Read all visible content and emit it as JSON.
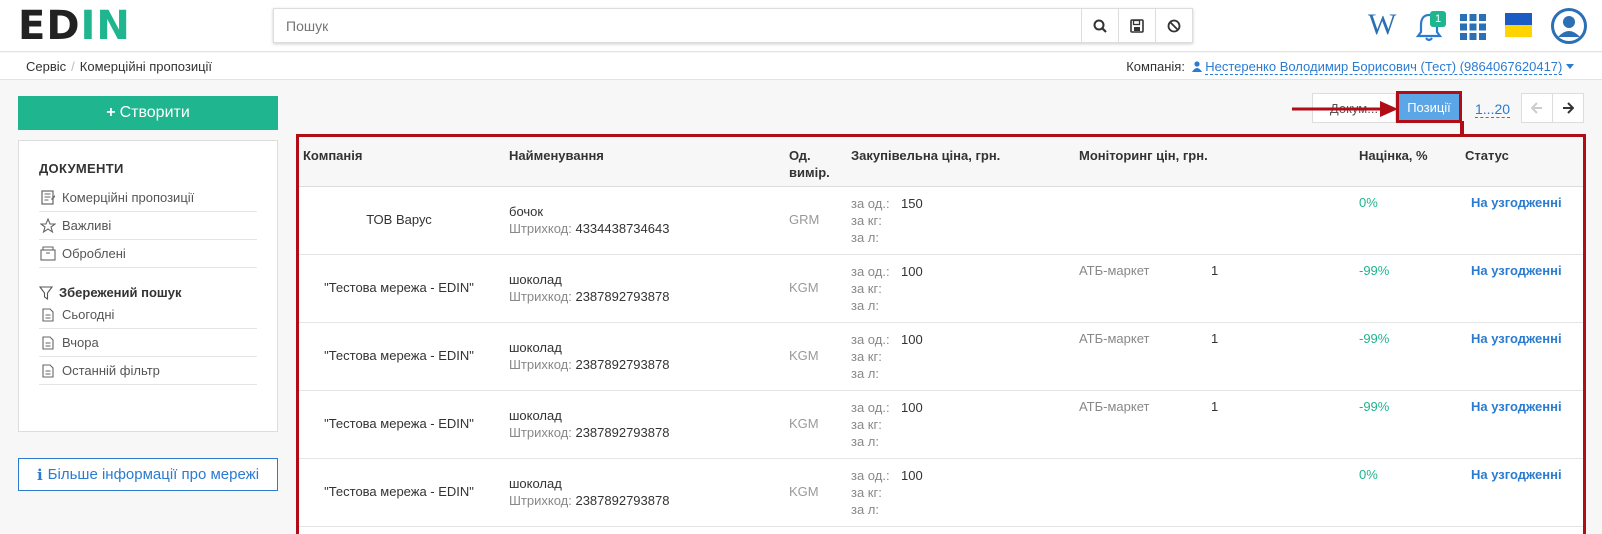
{
  "app": {
    "logo_ed": "ED",
    "logo_in": "IN"
  },
  "search": {
    "placeholder": "Пошук",
    "icons": [
      "search-icon",
      "save-icon",
      "ban-icon"
    ]
  },
  "topbar": {
    "wiki_label": "W",
    "notifications_count": "1",
    "icons": [
      "wiki-icon",
      "bell-icon",
      "apps-grid-icon",
      "ukraine-flag-icon",
      "user-avatar-icon"
    ]
  },
  "breadcrumb": {
    "items": [
      "Сервіс",
      "Комерційні пропозиції"
    ],
    "separator": "/"
  },
  "company": {
    "label": "Компанія:",
    "value": "Нестеренко Володимир Борисович (Тест) (9864067620417)"
  },
  "sidebar": {
    "create_label": "Створити",
    "documents_title": "ДОКУМЕНТИ",
    "documents": [
      {
        "label": "Комерційні пропозиції",
        "icon": "document-list-icon"
      },
      {
        "label": "Важливі",
        "icon": "star-icon"
      },
      {
        "label": "Оброблені",
        "icon": "archive-icon"
      }
    ],
    "saved_title": "Збережений пошук",
    "saved": [
      {
        "label": "Сьогодні",
        "icon": "file-icon"
      },
      {
        "label": "Вчора",
        "icon": "file-icon"
      },
      {
        "label": "Останній фільтр",
        "icon": "file-icon"
      }
    ],
    "info_label": "Більше інформації про мережі"
  },
  "toolbar": {
    "documents_tab": "Докум...",
    "positions_tab": "Позиції",
    "range": "1...20"
  },
  "table": {
    "headers": {
      "company": "Компанія",
      "name": "Найменування",
      "unit_1": "Од.",
      "unit_2": "вимір.",
      "price": "Закупівельна ціна, грн.",
      "monitoring": "Моніторинг цін, грн.",
      "markup": "Націнка, %",
      "status": "Статус"
    },
    "price_labels": {
      "per_unit": "за од.:",
      "per_kg": "за кг:",
      "per_l": "за л:"
    },
    "barcode_label": "Штрихкод:",
    "rows": [
      {
        "company": "ТОВ Варус",
        "name": "бочок",
        "barcode": "4334438734643",
        "unit": "GRM",
        "price": "150",
        "mon_shop": "",
        "mon_val": "",
        "markup": "0%",
        "status": "На узгодженні"
      },
      {
        "company": "\"Тестова мережа - EDIN\"",
        "name": "шоколад",
        "barcode": "2387892793878",
        "unit": "KGM",
        "price": "100",
        "mon_shop": "АТБ-маркет",
        "mon_val": "1",
        "markup": "-99%",
        "status": "На узгодженні"
      },
      {
        "company": "\"Тестова мережа - EDIN\"",
        "name": "шоколад",
        "barcode": "2387892793878",
        "unit": "KGM",
        "price": "100",
        "mon_shop": "АТБ-маркет",
        "mon_val": "1",
        "markup": "-99%",
        "status": "На узгодженні"
      },
      {
        "company": "\"Тестова мережа - EDIN\"",
        "name": "шоколад",
        "barcode": "2387892793878",
        "unit": "KGM",
        "price": "100",
        "mon_shop": "АТБ-маркет",
        "mon_val": "1",
        "markup": "-99%",
        "status": "На узгодженні"
      },
      {
        "company": "\"Тестова мережа - EDIN\"",
        "name": "шоколад",
        "barcode": "2387892793878",
        "unit": "KGM",
        "price": "100",
        "mon_shop": "",
        "mon_val": "",
        "markup": "0%",
        "status": "На узгодженні"
      }
    ]
  },
  "colors": {
    "brand_green": "#1fb58f",
    "link_blue": "#2b7bd1",
    "highlight_red": "#b00d17",
    "active_tab": "#5aa6e6"
  }
}
